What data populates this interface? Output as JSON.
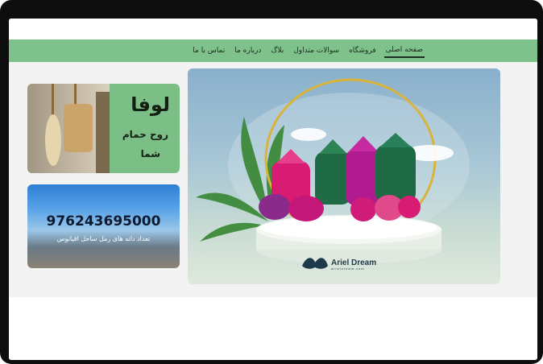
{
  "nav": {
    "items": [
      {
        "label": "صفحه اصلی",
        "active": true
      },
      {
        "label": "فروشگاه",
        "active": false
      },
      {
        "label": "سوالات متداول",
        "active": false
      },
      {
        "label": "بلاگ",
        "active": false
      },
      {
        "label": "درباره ما",
        "active": false
      },
      {
        "label": "تماس با ما",
        "active": false
      }
    ]
  },
  "banner": {
    "brand_name": "Ariel Dream",
    "brand_url": "arieldream.com"
  },
  "promo_loofah": {
    "title": "لوفا",
    "line1": "روح حمام",
    "line2": "شما"
  },
  "promo_count": {
    "number": "976243695000",
    "caption": "تعداد دانه های رمل ساحل اقیانوس"
  },
  "colors": {
    "nav_bg": "#7fc18a",
    "card_green": "#7cbf86",
    "device_frame": "#0d0d0d"
  }
}
